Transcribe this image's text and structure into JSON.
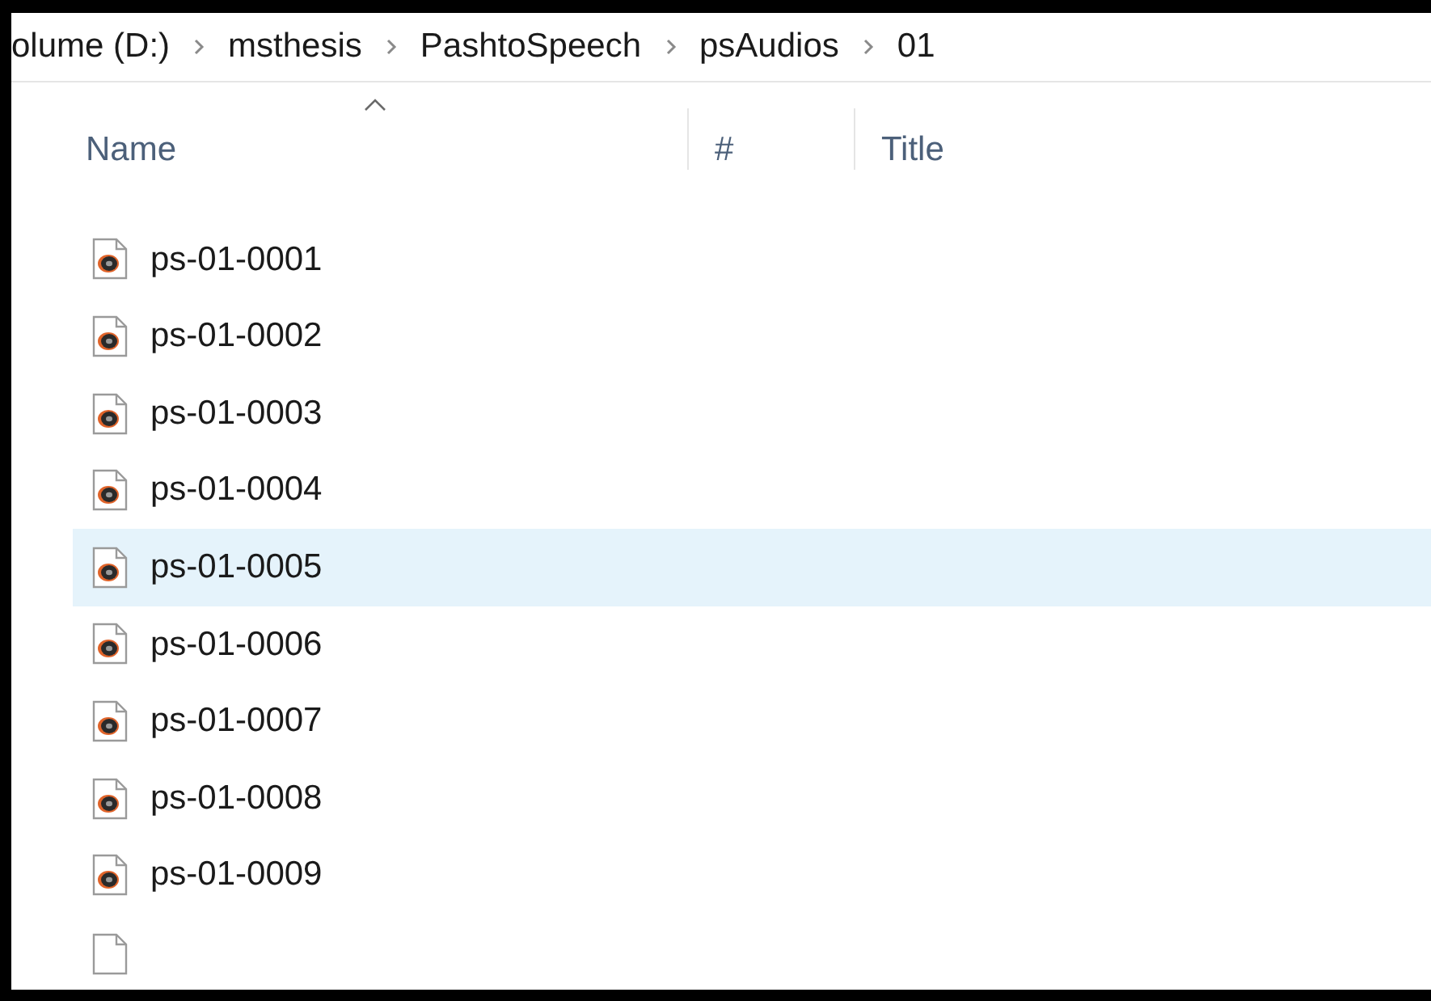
{
  "breadcrumb": [
    "olume (D:)",
    "msthesis",
    "PashtoSpeech",
    "psAudios",
    "01"
  ],
  "columns": [
    {
      "label": "Name",
      "sorted": true
    },
    {
      "label": "#",
      "sorted": false
    },
    {
      "label": "Title",
      "sorted": false
    }
  ],
  "files": [
    {
      "name": "ps-01-0001",
      "selected": false
    },
    {
      "name": "ps-01-0002",
      "selected": false
    },
    {
      "name": "ps-01-0003",
      "selected": false
    },
    {
      "name": "ps-01-0004",
      "selected": false
    },
    {
      "name": "ps-01-0005",
      "selected": true
    },
    {
      "name": "ps-01-0006",
      "selected": false
    },
    {
      "name": "ps-01-0007",
      "selected": false
    },
    {
      "name": "ps-01-0008",
      "selected": false
    },
    {
      "name": "ps-01-0009",
      "selected": false
    }
  ]
}
